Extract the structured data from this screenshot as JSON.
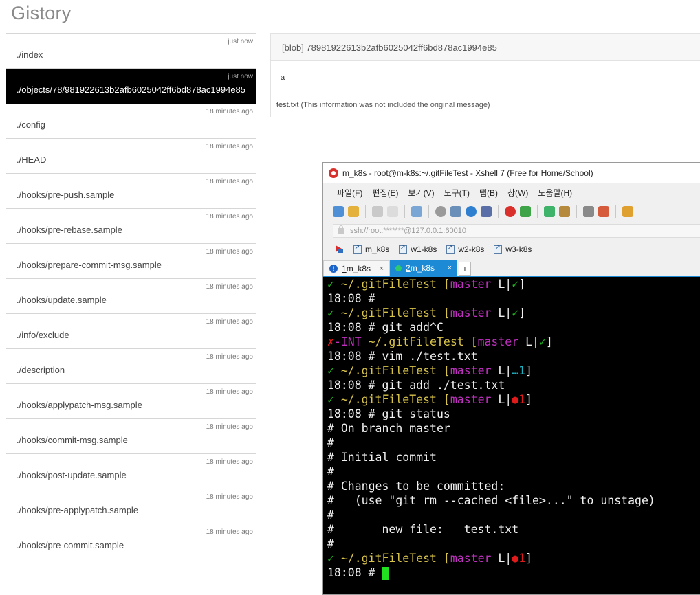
{
  "app": {
    "title": "Gistory"
  },
  "files": [
    {
      "path": "./index",
      "time": "just now",
      "active": false
    },
    {
      "path": "./objects/78/981922613b2afb6025042ff6bd878ac1994e85",
      "time": "just now",
      "active": true
    },
    {
      "path": "./config",
      "time": "18 minutes ago",
      "active": false
    },
    {
      "path": "./HEAD",
      "time": "18 minutes ago",
      "active": false
    },
    {
      "path": "./hooks/pre-push.sample",
      "time": "18 minutes ago",
      "active": false
    },
    {
      "path": "./hooks/pre-rebase.sample",
      "time": "18 minutes ago",
      "active": false
    },
    {
      "path": "./hooks/prepare-commit-msg.sample",
      "time": "18 minutes ago",
      "active": false
    },
    {
      "path": "./hooks/update.sample",
      "time": "18 minutes ago",
      "active": false
    },
    {
      "path": "./info/exclude",
      "time": "18 minutes ago",
      "active": false
    },
    {
      "path": "./description",
      "time": "18 minutes ago",
      "active": false
    },
    {
      "path": "./hooks/applypatch-msg.sample",
      "time": "18 minutes ago",
      "active": false
    },
    {
      "path": "./hooks/commit-msg.sample",
      "time": "18 minutes ago",
      "active": false
    },
    {
      "path": "./hooks/post-update.sample",
      "time": "18 minutes ago",
      "active": false
    },
    {
      "path": "./hooks/pre-applypatch.sample",
      "time": "18 minutes ago",
      "active": false
    },
    {
      "path": "./hooks/pre-commit.sample",
      "time": "18 minutes ago",
      "active": false
    }
  ],
  "detail": {
    "header": "[blob] 78981922613b2afb6025042ff6bd878ac1994e85",
    "content": "a",
    "file_name": "test.txt",
    "note": " (This information was not included the original message)"
  },
  "xshell": {
    "title": "m_k8s - root@m-k8s:~/.gitFileTest - Xshell 7 (Free for Home/School)",
    "menu": [
      "파일(F)",
      "편집(E)",
      "보기(V)",
      "도구(T)",
      "탭(B)",
      "창(W)",
      "도움말(H)"
    ],
    "address": "ssh://root:*******@127.0.0.1:60010",
    "quick_links": [
      "m_k8s",
      "w1-k8s",
      "w2-k8s",
      "w3-k8s"
    ],
    "tabs": [
      {
        "num": "1",
        "label": " m_k8s",
        "active": false
      },
      {
        "num": "2",
        "label": " m_k8s",
        "active": true
      }
    ],
    "tab_close": "×",
    "tab_add": "+",
    "terminal": [
      [
        [
          "✓ ",
          "green"
        ],
        [
          "~/.gitFileTest ",
          "yellow"
        ],
        [
          "[",
          "yellow"
        ],
        [
          "master",
          "magenta"
        ],
        [
          " L|",
          "white"
        ],
        [
          "✓",
          "green"
        ],
        [
          "]",
          "white"
        ]
      ],
      [
        [
          "18:08 #",
          "white"
        ]
      ],
      [
        [
          "✓ ",
          "green"
        ],
        [
          "~/.gitFileTest ",
          "yellow"
        ],
        [
          "[",
          "yellow"
        ],
        [
          "master",
          "magenta"
        ],
        [
          " L|",
          "white"
        ],
        [
          "✓",
          "green"
        ],
        [
          "]",
          "white"
        ]
      ],
      [
        [
          "18:08 # git add^C",
          "white"
        ]
      ],
      [
        [
          "✗",
          "red"
        ],
        [
          "-INT ",
          "magenta"
        ],
        [
          "~/.gitFileTest ",
          "yellow"
        ],
        [
          "[",
          "yellow"
        ],
        [
          "master",
          "magenta"
        ],
        [
          " L|",
          "white"
        ],
        [
          "✓",
          "green"
        ],
        [
          "]",
          "white"
        ]
      ],
      [
        [
          "18:08 # vim ./test.txt",
          "white"
        ]
      ],
      [
        [
          "✓ ",
          "green"
        ],
        [
          "~/.gitFileTest ",
          "yellow"
        ],
        [
          "[",
          "yellow"
        ],
        [
          "master",
          "magenta"
        ],
        [
          " L|",
          "white"
        ],
        [
          "…1",
          "cyan"
        ],
        [
          "]",
          "white"
        ]
      ],
      [
        [
          "18:08 # git add ./test.txt",
          "white"
        ]
      ],
      [
        [
          "✓ ",
          "green"
        ],
        [
          "~/.gitFileTest ",
          "yellow"
        ],
        [
          "[",
          "yellow"
        ],
        [
          "master",
          "magenta"
        ],
        [
          " L|",
          "white"
        ],
        [
          "●1",
          "red"
        ],
        [
          "]",
          "white"
        ]
      ],
      [
        [
          "18:08 # git status",
          "white"
        ]
      ],
      [
        [
          "# On branch master",
          "white"
        ]
      ],
      [
        [
          "#",
          "white"
        ]
      ],
      [
        [
          "# Initial commit",
          "white"
        ]
      ],
      [
        [
          "#",
          "white"
        ]
      ],
      [
        [
          "# Changes to be committed:",
          "white"
        ]
      ],
      [
        [
          "#   (use \"git rm --cached <file>...\" to unstage)",
          "white"
        ]
      ],
      [
        [
          "#",
          "white"
        ]
      ],
      [
        [
          "#       new file:   test.txt",
          "white"
        ]
      ],
      [
        [
          "#",
          "white"
        ]
      ],
      [
        [
          "✓ ",
          "green"
        ],
        [
          "~/.gitFileTest ",
          "yellow"
        ],
        [
          "[",
          "yellow"
        ],
        [
          "master",
          "magenta"
        ],
        [
          " L|",
          "white"
        ],
        [
          "●1",
          "red"
        ],
        [
          "]",
          "white"
        ]
      ],
      [
        [
          "18:08 # ",
          "white"
        ]
      ]
    ]
  },
  "colors": {
    "terminal_bg": "#000000",
    "tab_active": "#1d8ad6",
    "cursor": "#20e020"
  }
}
